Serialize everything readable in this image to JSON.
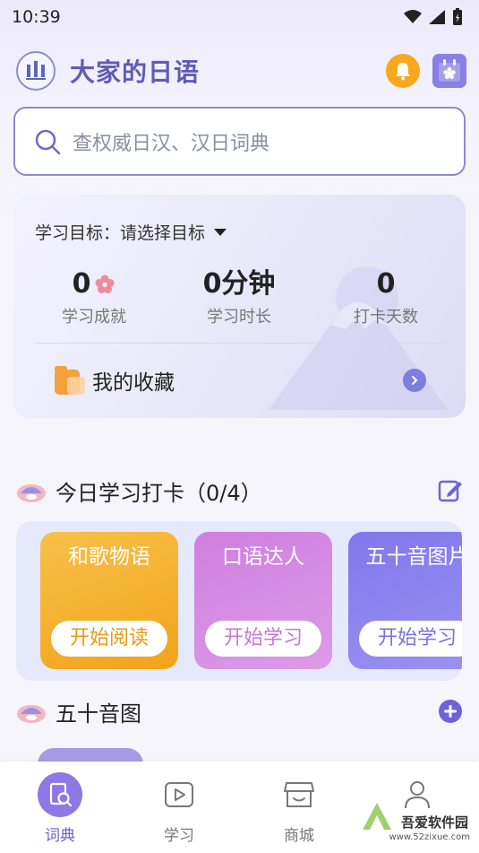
{
  "status_bar": {
    "time": "10:39"
  },
  "header": {
    "title": "大家的日语"
  },
  "search": {
    "placeholder": "查权威日汉、汉日词典"
  },
  "study_card": {
    "goal_label": "学习目标：",
    "goal_value": "请选择目标",
    "stats": [
      {
        "value": "0",
        "label": "学习成就"
      },
      {
        "value": "0分钟",
        "label": "学习时长"
      },
      {
        "value": "0",
        "label": "打卡天数"
      }
    ],
    "favorites_label": "我的收藏"
  },
  "checkin": {
    "title": "今日学习打卡（0/4）",
    "cards": [
      {
        "name": "和歌物语",
        "button": "开始阅读"
      },
      {
        "name": "口语达人",
        "button": "开始学习"
      },
      {
        "name": "五十音图片",
        "button": "开始学习"
      }
    ]
  },
  "gojuon": {
    "title": "五十音图"
  },
  "bottom_nav": [
    {
      "label": "词典"
    },
    {
      "label": "学习"
    },
    {
      "label": "商城"
    },
    {
      "label": ""
    }
  ],
  "watermark": {
    "name": "吾爱软件园",
    "url": "www.52zixue.com"
  },
  "colors": {
    "brand": "#5f5cb6",
    "accent": "#6a5fd6",
    "card_orange": "#f7b52c",
    "card_pink": "#d78fe6",
    "card_purple": "#8b85ee"
  }
}
